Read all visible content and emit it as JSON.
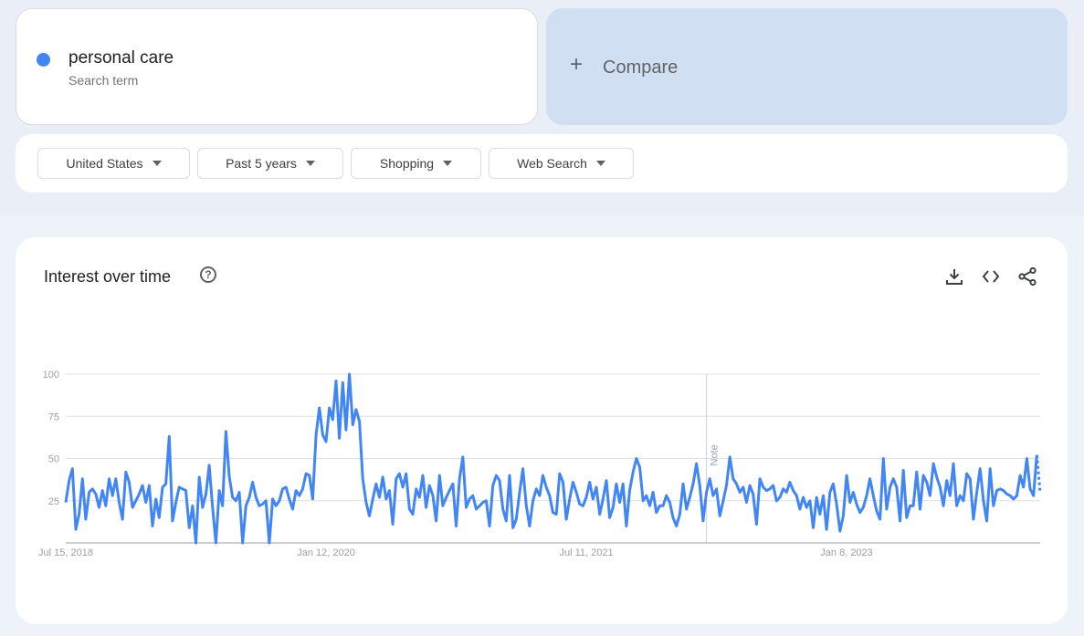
{
  "search_term": {
    "name": "personal care",
    "subtitle": "Search term",
    "color": "#4285f4"
  },
  "compare": {
    "label": "Compare",
    "icon": "plus-icon"
  },
  "filters": [
    {
      "label": "United States"
    },
    {
      "label": "Past 5 years"
    },
    {
      "label": "Shopping"
    },
    {
      "label": "Web Search"
    }
  ],
  "chart_panel": {
    "title": "Interest over time",
    "help_icon": "help-circle-icon",
    "tools": [
      "download-icon",
      "embed-code-icon",
      "share-icon"
    ]
  },
  "chart_data": {
    "type": "line",
    "title": "Interest over time",
    "xlabel": "",
    "ylabel": "",
    "ylim": [
      0,
      100
    ],
    "yticks": [
      25,
      50,
      75,
      100
    ],
    "grid": true,
    "x_tick_labels": [
      "Jul 15, 2018",
      "Jan 12, 2020",
      "Jul 11, 2021",
      "Jan 8, 2023"
    ],
    "x_tick_index": [
      0,
      78,
      156,
      234
    ],
    "annotation": {
      "label": "Note",
      "index": 192
    },
    "partial_from_index": 260,
    "series": [
      {
        "name": "personal care",
        "color": "#4285f4",
        "values": [
          24,
          37,
          44,
          8,
          17,
          38,
          14,
          30,
          32,
          29,
          21,
          31,
          22,
          38,
          28,
          38,
          24,
          14,
          42,
          36,
          21,
          25,
          29,
          34,
          24,
          34,
          10,
          26,
          15,
          33,
          35,
          63,
          13,
          24,
          33,
          32,
          31,
          9,
          22,
          0,
          39,
          21,
          29,
          46,
          21,
          0,
          31,
          22,
          66,
          39,
          27,
          25,
          30,
          0,
          22,
          27,
          36,
          27,
          22,
          23,
          25,
          0,
          26,
          22,
          25,
          32,
          33,
          26,
          20,
          31,
          28,
          32,
          41,
          40,
          26,
          64,
          80,
          64,
          60,
          80,
          73,
          96,
          62,
          95,
          67,
          100,
          70,
          79,
          72,
          38,
          24,
          16,
          26,
          35,
          27,
          39,
          26,
          31,
          11,
          38,
          41,
          33,
          41,
          20,
          17,
          32,
          27,
          40,
          21,
          34,
          28,
          13,
          40,
          22,
          27,
          31,
          35,
          10,
          38,
          51,
          21,
          26,
          28,
          20,
          22,
          24,
          25,
          10,
          34,
          40,
          37,
          20,
          13,
          40,
          9,
          14,
          30,
          44,
          22,
          10,
          25,
          32,
          28,
          40,
          33,
          28,
          18,
          17,
          41,
          36,
          14,
          26,
          36,
          30,
          23,
          22,
          27,
          36,
          26,
          33,
          17,
          26,
          37,
          15,
          21,
          35,
          24,
          35,
          10,
          31,
          42,
          50,
          45,
          25,
          28,
          22,
          30,
          18,
          22,
          22,
          28,
          24,
          15,
          10,
          17,
          35,
          20,
          27,
          35,
          47,
          34,
          13,
          30,
          38,
          28,
          32,
          16,
          25,
          34,
          51,
          38,
          35,
          30,
          33,
          24,
          34,
          29,
          11,
          38,
          33,
          31,
          32,
          34,
          25,
          27,
          32,
          30,
          36,
          31,
          28,
          20,
          27,
          21,
          25,
          9,
          27,
          17,
          28,
          8,
          30,
          35,
          23,
          7,
          16,
          40,
          24,
          30,
          23,
          18,
          21,
          28,
          38,
          28,
          19,
          14,
          50,
          20,
          33,
          38,
          33,
          13,
          43,
          15,
          22,
          22,
          42,
          20,
          40,
          36,
          28,
          47,
          39,
          33,
          22,
          37,
          28,
          47,
          22,
          28,
          25,
          41,
          38,
          14,
          30,
          44,
          25,
          13,
          44,
          22,
          31,
          32,
          31,
          29,
          28,
          26,
          28,
          40,
          33,
          50,
          32,
          28,
          52
        ],
        "partial_tail": [
          52,
          30
        ]
      }
    ]
  }
}
